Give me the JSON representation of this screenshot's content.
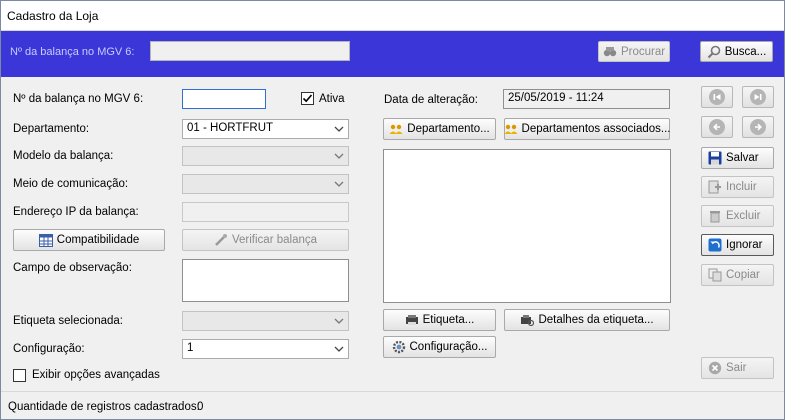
{
  "window": {
    "title": "Cadastro da Loja"
  },
  "topbar": {
    "label": "Nº da balança no MGV 6:",
    "value": "",
    "procurar_label": "Procurar",
    "busca_label": "Busca..."
  },
  "form": {
    "balanca_label": "Nº da balança no MGV 6:",
    "balanca_value": "",
    "ativa_label": "Ativa",
    "departamento_label": "Departamento:",
    "departamento_value": "01 - HORTFRUT",
    "modelo_label": "Modelo da balança:",
    "modelo_value": "",
    "meio_label": "Meio de comunicação:",
    "meio_value": "",
    "ip_label": "Endereço IP da balança:",
    "ip_value": "",
    "compat_label": "Compatibilidade",
    "verificar_label": "Verificar balança",
    "observacao_label": "Campo de observação:",
    "etiqueta_label": "Etiqueta selecionada:",
    "etiqueta_value": "",
    "config_label": "Configuração:",
    "config_value": "1",
    "avancadas_label": "Exibir opções avançadas"
  },
  "right": {
    "data_label": "Data de alteração:",
    "data_value": "25/05/2019 - 11:24",
    "departamento_btn": "Departamento...",
    "assoc_btn": "Departamentos associados...",
    "etiqueta_btn": "Etiqueta...",
    "detalhes_btn": "Detalhes da etiqueta...",
    "config_btn": "Configuração..."
  },
  "actions": {
    "salvar": "Salvar",
    "incluir": "Incluir",
    "excluir": "Excluir",
    "ignorar": "Ignorar",
    "copiar": "Copiar",
    "sair": "Sair"
  },
  "status": {
    "label": "Quantidade de registros cadastrados:",
    "count": "0"
  },
  "colors": {
    "topbar": "#3a36d8",
    "accent_focus": "#2f6fd3",
    "save_blue": "#1a3f9c"
  }
}
